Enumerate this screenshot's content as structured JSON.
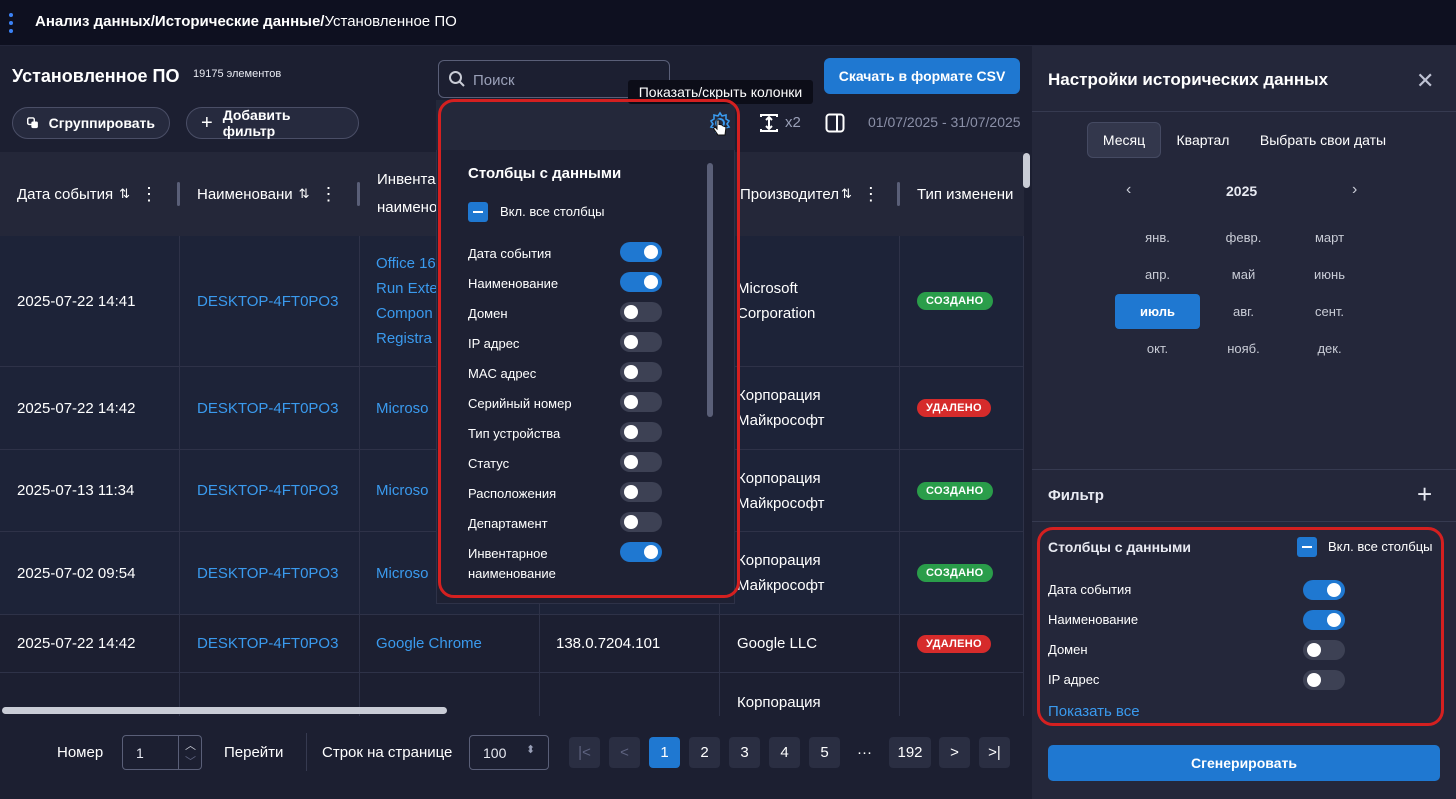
{
  "breadcrumb": {
    "part1": "Анализ данных/",
    "part2": "Исторические данные/",
    "part3": "Установленное ПО"
  },
  "header": {
    "title": "Установленное ПО",
    "count": "19175 элементов"
  },
  "search": {
    "placeholder": "Поиск"
  },
  "toolbar": {
    "download_csv": "Скачать в формате CSV",
    "tooltip": "Показать/скрыть колонки",
    "group": "Сгруппировать",
    "add_filter": "Добавить фильтр",
    "density": "x2",
    "date_range": "01/07/2025 - 31/07/2025"
  },
  "table": {
    "columns": [
      "Дата события",
      "Наименовани",
      "Инвента",
      "наимено",
      "Производител",
      "Тип изменени"
    ],
    "rows": [
      {
        "date": "2025-07-22 14:41",
        "name": "DESKTOP-4FT0PO3",
        "inv": [
          "Office 16",
          "Run Exte",
          "Compon",
          "Registra"
        ],
        "version": "",
        "vendor": [
          "Microsoft",
          "Corporation"
        ],
        "change": "СОЗДАНО",
        "kind": "created"
      },
      {
        "date": "2025-07-22 14:42",
        "name": "DESKTOP-4FT0PO3",
        "inv": [
          "Microso"
        ],
        "version": "",
        "vendor": [
          "Корпорация",
          "Майкрософт"
        ],
        "change": "УДАЛЕНО",
        "kind": "deleted"
      },
      {
        "date": "2025-07-13 11:34",
        "name": "DESKTOP-4FT0PO3",
        "inv": [
          "Microso"
        ],
        "version": "",
        "vendor": [
          "Корпорация",
          "Майкрософт"
        ],
        "change": "СОЗДАНО",
        "kind": "created"
      },
      {
        "date": "2025-07-02 09:54",
        "name": "DESKTOP-4FT0PO3",
        "inv": [
          "Microso"
        ],
        "version": "",
        "vendor": [
          "Корпорация",
          "Майкрософт"
        ],
        "change": "СОЗДАНО",
        "kind": "created"
      },
      {
        "date": "2025-07-22 14:42",
        "name": "DESKTOP-4FT0PO3",
        "inv": [
          "Google Chrome"
        ],
        "version": "138.0.7204.101",
        "vendor": [
          "Google LLC"
        ],
        "change": "УДАЛЕНО",
        "kind": "deleted"
      },
      {
        "date": "",
        "name": "",
        "inv": [
          ""
        ],
        "version": "",
        "vendor": [
          "Корпорация"
        ],
        "change": "",
        "kind": "deleted"
      }
    ]
  },
  "pagination": {
    "number_label": "Номер",
    "number_value": "1",
    "go": "Перейти",
    "rows_label": "Строк на странице",
    "rows_value": "100",
    "pages": [
      "1",
      "2",
      "3",
      "4",
      "5"
    ],
    "ellipsis": "···",
    "last_page": "192",
    "current_page": "1"
  },
  "popup": {
    "title": "Столбцы с данными",
    "select_all": "Вкл. все столбцы",
    "options": [
      {
        "label": "Дата события",
        "on": true
      },
      {
        "label": "Наименование",
        "on": true
      },
      {
        "label": "Домен",
        "on": false
      },
      {
        "label": "IP адрес",
        "on": false
      },
      {
        "label": "MAC адрес",
        "on": false
      },
      {
        "label": "Серийный номер",
        "on": false
      },
      {
        "label": "Тип устройства",
        "on": false
      },
      {
        "label": "Статус",
        "on": false
      },
      {
        "label": "Расположения",
        "on": false
      },
      {
        "label": "Департамент",
        "on": false
      },
      {
        "label": "Инвентарное",
        "label2": "наименование",
        "on": true
      }
    ]
  },
  "panel": {
    "title": "Настройки исторических данных",
    "tabs": [
      "Месяц",
      "Квартал",
      "Выбрать свои даты"
    ],
    "active_tab": "Месяц",
    "year": "2025",
    "months": [
      "янв.",
      "февр.",
      "март",
      "апр.",
      "май",
      "июнь",
      "июль",
      "авг.",
      "сент.",
      "окт.",
      "нояб.",
      "дек."
    ],
    "selected_month": "июль",
    "filter_label": "Фильтр",
    "columns_title": "Столбцы с данными",
    "select_all": "Вкл. все столбцы",
    "column_options": [
      {
        "label": "Дата события",
        "on": true
      },
      {
        "label": "Наименование",
        "on": true
      },
      {
        "label": "Домен",
        "on": false
      },
      {
        "label": "IP адрес",
        "on": false
      }
    ],
    "show_all": "Показать все",
    "generate": "Сгенерировать"
  },
  "colors": {
    "accent": "#1f78d1",
    "link": "#3a9aee",
    "created": "#2a9d4a",
    "deleted": "#d62b2b",
    "highlight": "#d42020"
  }
}
